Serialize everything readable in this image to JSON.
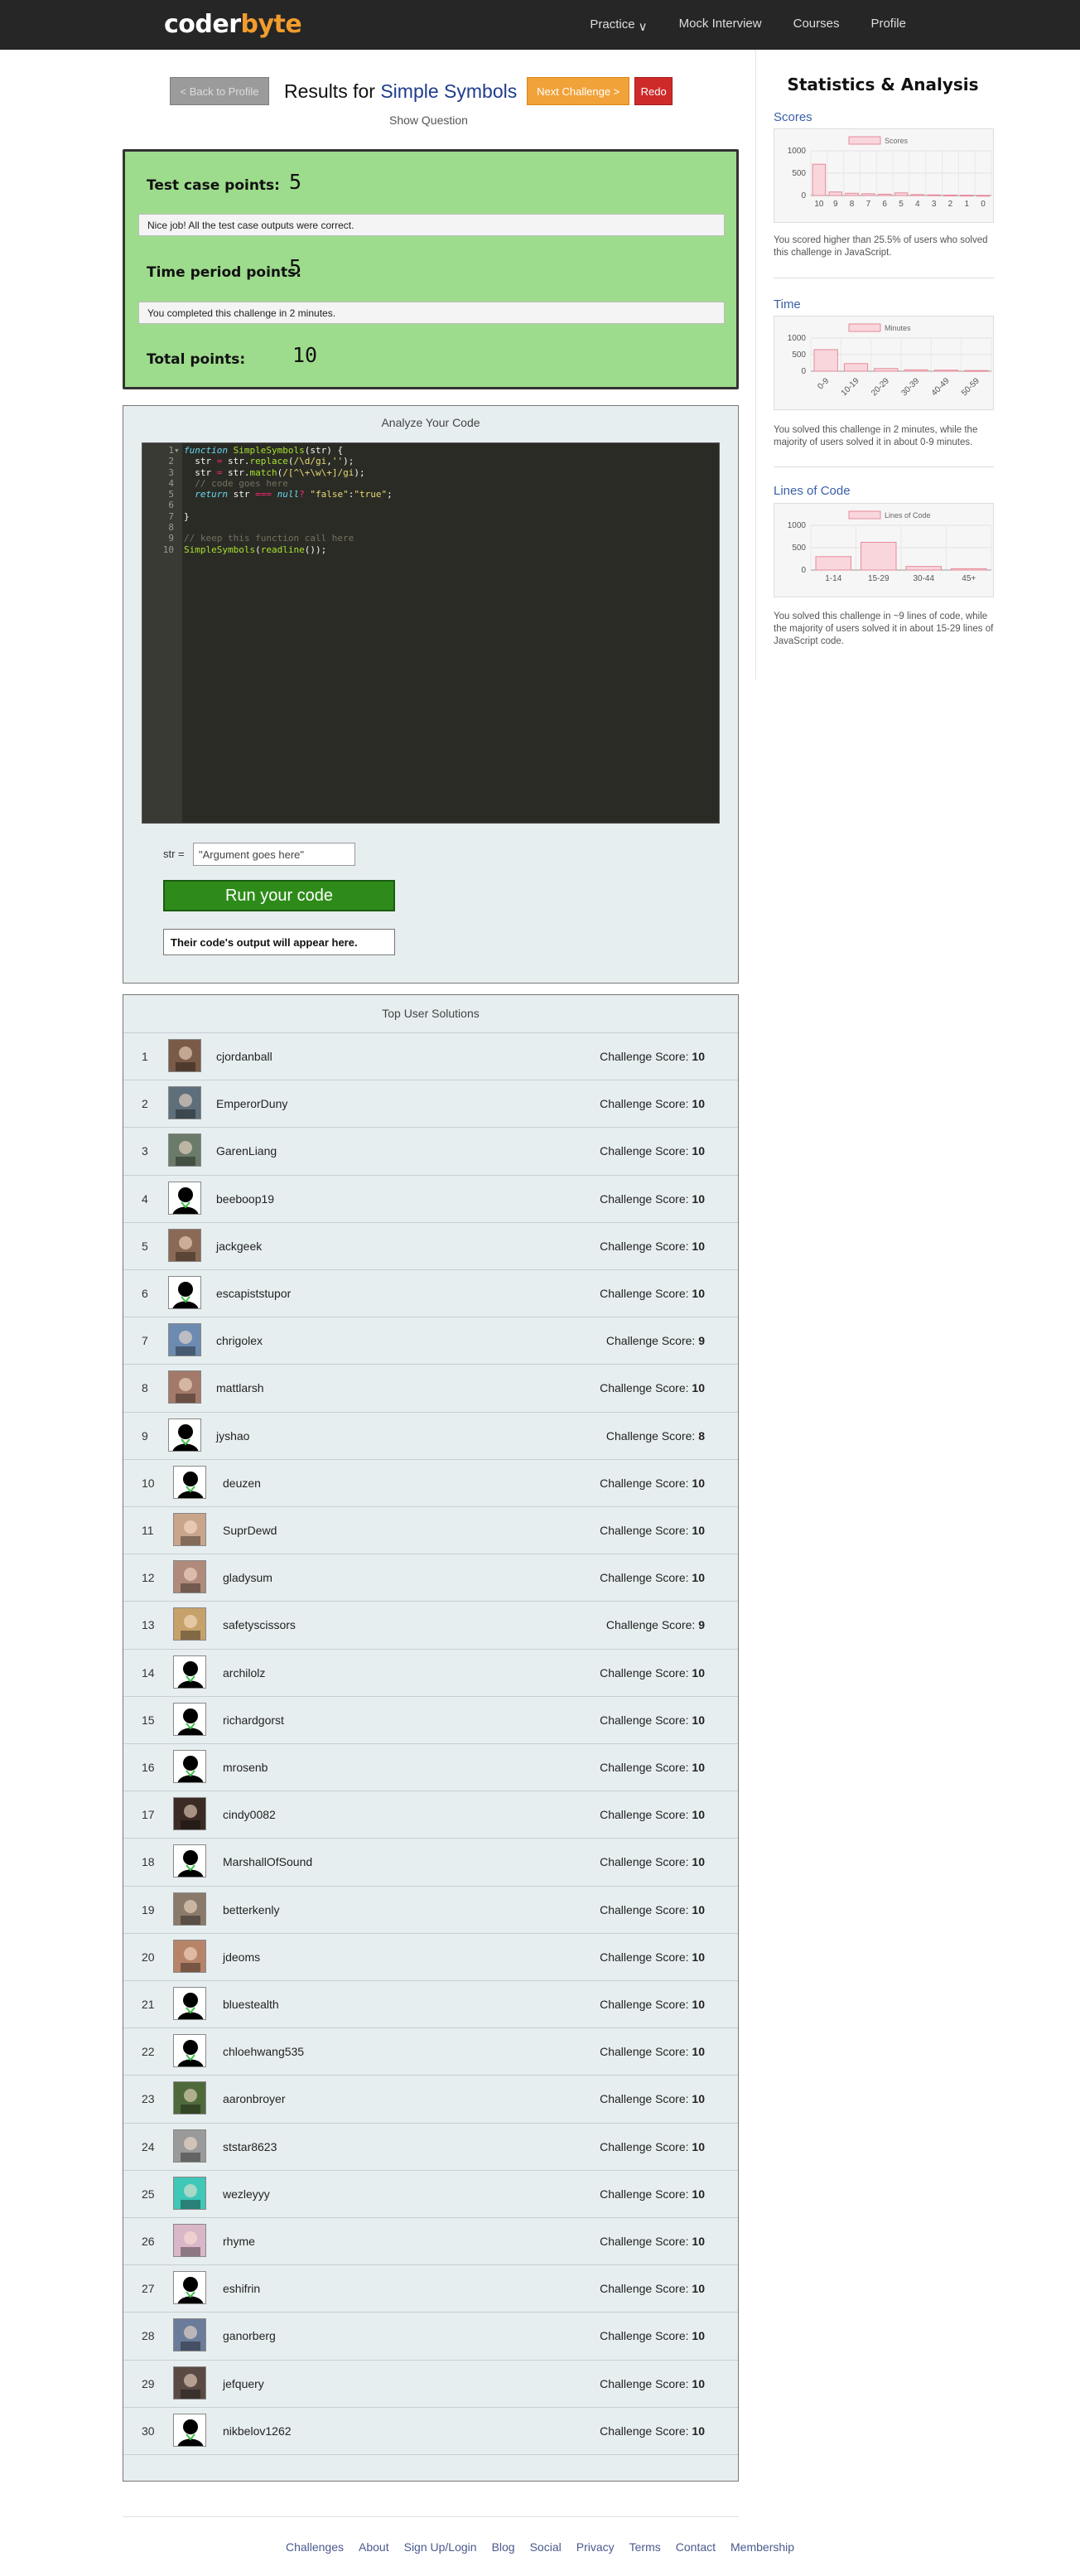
{
  "nav": {
    "logo_a": "coder",
    "logo_b": "byte",
    "links": [
      "Practice",
      "Mock Interview",
      "Courses",
      "Profile"
    ]
  },
  "header": {
    "back_label": "< Back to Profile",
    "title_prefix": "Results for ",
    "title_link": "Simple Symbols",
    "next_label": "Next Challenge >",
    "redo_label": "Redo",
    "show_question": "Show Question"
  },
  "points": {
    "test_case_label": "Test case points:",
    "test_case_value": "5",
    "test_case_msg": "Nice job! All the test case outputs were correct.",
    "time_label": "Time period points:",
    "time_value": "5",
    "time_msg": "You completed this challenge in 2 minutes.",
    "total_label": "Total points:",
    "total_value": "10"
  },
  "analyze": {
    "title": "Analyze Your Code",
    "code": [
      "function SimpleSymbols(str) {",
      "  str = str.replace(/\\d/gi,'');",
      "  str = str.match(/[^\\+\\w\\+]/gi);",
      "  // code goes here",
      "  return str === null? \"false\":\"true\";",
      "",
      "}",
      "",
      "// keep this function call here",
      "SimpleSymbols(readline());"
    ],
    "arg_label": "str =",
    "arg_value": "\"Argument goes here\"",
    "run_label": "Run your code",
    "output_text": "Their code's output will appear here."
  },
  "solutions": {
    "title": "Top User Solutions",
    "score_label": "Challenge Score:",
    "rows": [
      {
        "rank": "1",
        "user": "cjordanball",
        "score": "10"
      },
      {
        "rank": "2",
        "user": "EmperorDuny",
        "score": "10"
      },
      {
        "rank": "3",
        "user": "GarenLiang",
        "score": "10"
      },
      {
        "rank": "4",
        "user": "beeboop19",
        "score": "10"
      },
      {
        "rank": "5",
        "user": "jackgeek",
        "score": "10"
      },
      {
        "rank": "6",
        "user": "escapiststupor",
        "score": "10"
      },
      {
        "rank": "7",
        "user": "chrigolex",
        "score": "9"
      },
      {
        "rank": "8",
        "user": "mattlarsh",
        "score": "10"
      },
      {
        "rank": "9",
        "user": "jyshao",
        "score": "8"
      },
      {
        "rank": "10",
        "user": "deuzen",
        "score": "10"
      },
      {
        "rank": "11",
        "user": "SuprDewd",
        "score": "10"
      },
      {
        "rank": "12",
        "user": "gladysum",
        "score": "10"
      },
      {
        "rank": "13",
        "user": "safetyscissors",
        "score": "9"
      },
      {
        "rank": "14",
        "user": "archilolz",
        "score": "10"
      },
      {
        "rank": "15",
        "user": "richardgorst",
        "score": "10"
      },
      {
        "rank": "16",
        "user": "mrosenb",
        "score": "10"
      },
      {
        "rank": "17",
        "user": "cindy0082",
        "score": "10"
      },
      {
        "rank": "18",
        "user": "MarshallOfSound",
        "score": "10"
      },
      {
        "rank": "19",
        "user": "betterkenly",
        "score": "10"
      },
      {
        "rank": "20",
        "user": "jdeoms",
        "score": "10"
      },
      {
        "rank": "21",
        "user": "bluestealth",
        "score": "10"
      },
      {
        "rank": "22",
        "user": "chloehwang535",
        "score": "10"
      },
      {
        "rank": "23",
        "user": "aaronbroyer",
        "score": "10"
      },
      {
        "rank": "24",
        "user": "ststar8623",
        "score": "10"
      },
      {
        "rank": "25",
        "user": "wezleyyy",
        "score": "10"
      },
      {
        "rank": "26",
        "user": "rhyme",
        "score": "10"
      },
      {
        "rank": "27",
        "user": "eshifrin",
        "score": "10"
      },
      {
        "rank": "28",
        "user": "ganorberg",
        "score": "10"
      },
      {
        "rank": "29",
        "user": "jefquery",
        "score": "10"
      },
      {
        "rank": "30",
        "user": "nikbelov1262",
        "score": "10"
      }
    ]
  },
  "sidebar": {
    "title": "Statistics & Analysis",
    "colors": {
      "bar_fill": "#f9d6dc",
      "bar_stroke": "#e58a9a",
      "heading": "#3a5fa8"
    }
  },
  "chart_data": [
    {
      "type": "bar",
      "heading": "Scores",
      "legend": "Scores",
      "categories": [
        "10",
        "9",
        "8",
        "7",
        "6",
        "5",
        "4",
        "3",
        "2",
        "1",
        "0"
      ],
      "values": [
        700,
        80,
        50,
        40,
        30,
        60,
        20,
        15,
        10,
        8,
        5
      ],
      "ylim": [
        0,
        1000
      ],
      "yticks": [
        "1000",
        "500",
        "0"
      ],
      "caption": "You scored higher than 25.5% of users who solved this challenge in JavaScript."
    },
    {
      "type": "bar",
      "heading": "Time",
      "legend": "Minutes",
      "categories": [
        "0-9",
        "10-19",
        "20-29",
        "30-39",
        "40-49",
        "50-59"
      ],
      "values": [
        650,
        230,
        80,
        40,
        30,
        20
      ],
      "ylim": [
        0,
        1000
      ],
      "yticks": [
        "1000",
        "500",
        "0"
      ],
      "caption": "You solved this challenge in 2 minutes, while the majority of users solved it in about 0-9 minutes."
    },
    {
      "type": "bar",
      "heading": "Lines of Code",
      "legend": "Lines of Code",
      "categories": [
        "1-14",
        "15-29",
        "30-44",
        "45+"
      ],
      "values": [
        300,
        620,
        80,
        30
      ],
      "ylim": [
        0,
        1000
      ],
      "yticks": [
        "1000",
        "500",
        "0"
      ],
      "caption": "You solved this challenge in ~9 lines of code, while the majority of users solved it in about 15-29 lines of JavaScript code."
    }
  ],
  "footer": {
    "links": [
      "Challenges",
      "About",
      "Sign Up/Login",
      "Blog",
      "Social",
      "Privacy",
      "Terms",
      "Contact",
      "Membership"
    ]
  }
}
